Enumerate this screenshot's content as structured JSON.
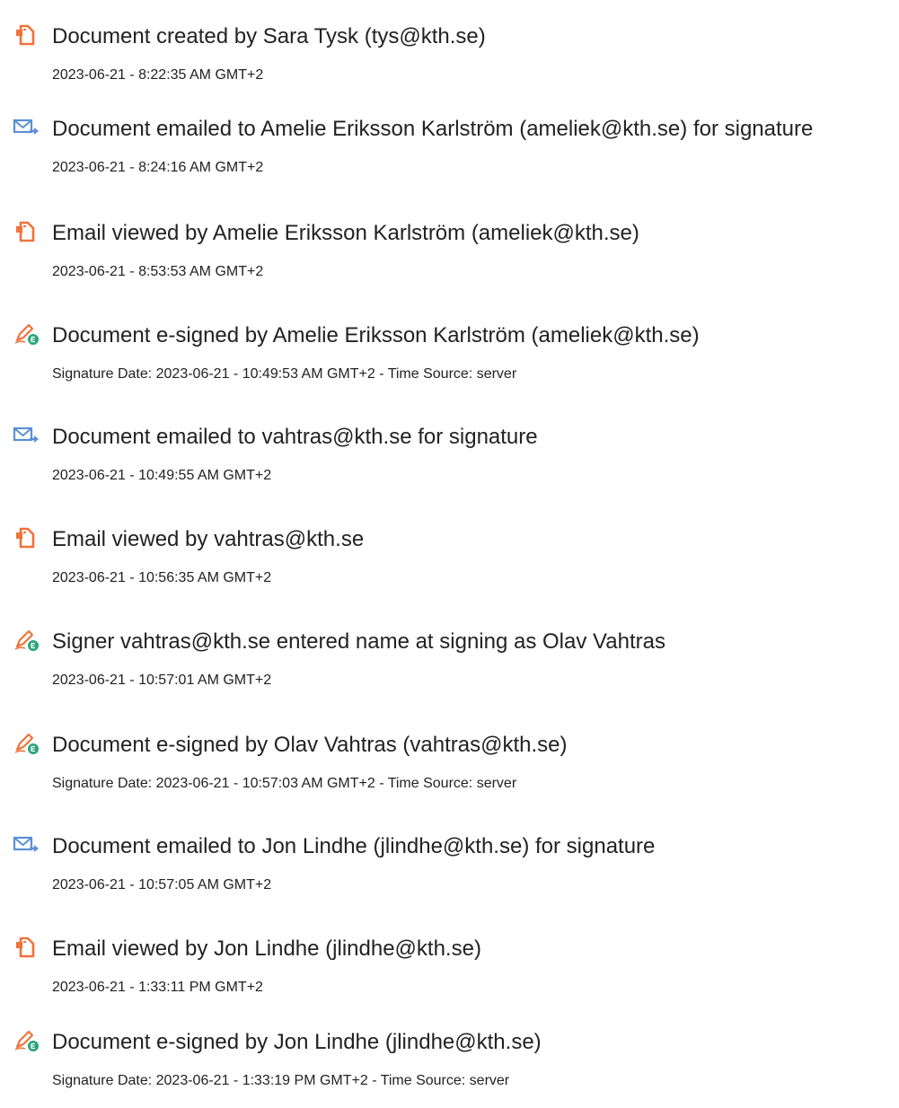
{
  "events": [
    {
      "icon": "document-created-icon",
      "title": "Document created by Sara Tysk (tys@kth.se)",
      "detail": "2023-06-21 - 8:22:35 AM GMT+2"
    },
    {
      "icon": "email-sent-icon",
      "title": "Document emailed to Amelie Eriksson Karlström (ameliek@kth.se) for signature",
      "detail": "2023-06-21 - 8:24:16 AM GMT+2"
    },
    {
      "icon": "document-viewed-icon",
      "title": "Email viewed by Amelie Eriksson Karlström (ameliek@kth.se)",
      "detail": "2023-06-21 - 8:53:53 AM GMT+2"
    },
    {
      "icon": "e-sign-pen-icon",
      "title": "Document e-signed by Amelie Eriksson Karlström (ameliek@kth.se)",
      "detail": "Signature Date: 2023-06-21 - 10:49:53 AM GMT+2 - Time Source: server"
    },
    {
      "icon": "email-sent-icon",
      "title": "Document emailed to vahtras@kth.se for signature",
      "detail": "2023-06-21 - 10:49:55 AM GMT+2"
    },
    {
      "icon": "document-viewed-icon",
      "title": "Email viewed by vahtras@kth.se",
      "detail": "2023-06-21 - 10:56:35 AM GMT+2"
    },
    {
      "icon": "e-sign-pen-icon",
      "title": "Signer vahtras@kth.se entered name at signing as Olav Vahtras",
      "detail": "2023-06-21 - 10:57:01 AM GMT+2"
    },
    {
      "icon": "e-sign-pen-icon",
      "title": "Document e-signed by Olav Vahtras (vahtras@kth.se)",
      "detail": "Signature Date: 2023-06-21 - 10:57:03 AM GMT+2 - Time Source: server"
    },
    {
      "icon": "email-sent-icon",
      "title": "Document emailed to Jon Lindhe (jlindhe@kth.se) for signature",
      "detail": "2023-06-21 - 10:57:05 AM GMT+2"
    },
    {
      "icon": "document-viewed-icon",
      "title": "Email viewed by Jon Lindhe (jlindhe@kth.se)",
      "detail": "2023-06-21 - 1:33:11 PM GMT+2"
    },
    {
      "icon": "e-sign-pen-icon",
      "title": "Document e-signed by Jon Lindhe (jlindhe@kth.se)",
      "detail": "Signature Date: 2023-06-21 - 1:33:19 PM GMT+2 - Time Source: server"
    }
  ],
  "colors": {
    "document_icon": "#f0733c",
    "email_icon": "#5b8fd6",
    "pen_icon": "#2aa37a",
    "text": "#222222"
  }
}
